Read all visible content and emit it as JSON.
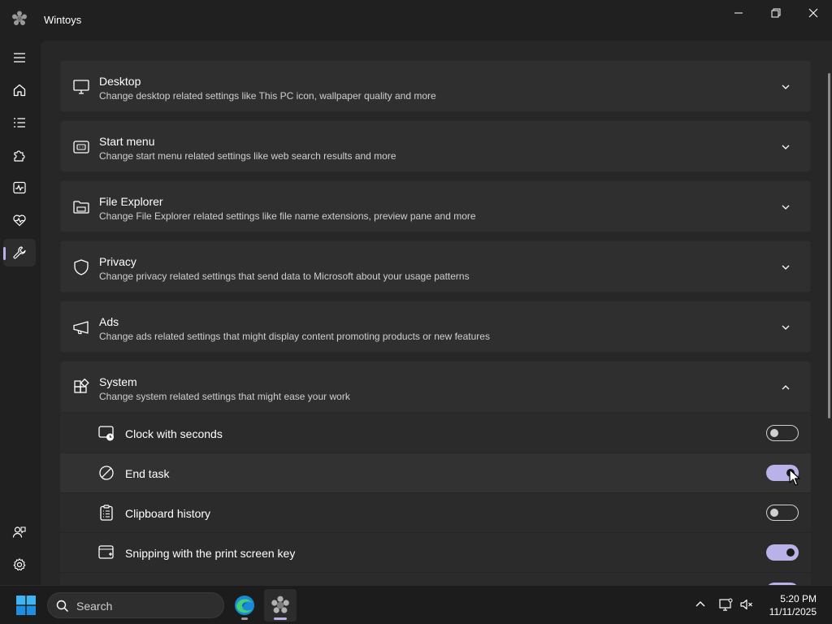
{
  "window": {
    "title": "Wintoys"
  },
  "nav": [
    {
      "icon": "hamburger-menu-icon"
    },
    {
      "icon": "home-icon"
    },
    {
      "icon": "apps-list-icon"
    },
    {
      "icon": "puzzle-icon"
    },
    {
      "icon": "performance-icon"
    },
    {
      "icon": "health-icon"
    },
    {
      "icon": "tweaks-wrench-icon",
      "active": true
    },
    {
      "icon": "account-icon"
    },
    {
      "icon": "settings-gear-icon"
    }
  ],
  "sections": [
    {
      "title": "Desktop",
      "subtitle": "Change desktop related settings like This PC icon, wallpaper quality and more",
      "icon": "monitor-icon",
      "expanded": false
    },
    {
      "title": "Start menu",
      "subtitle": "Change start menu related settings like web search results and more",
      "icon": "start-menu-icon",
      "expanded": false
    },
    {
      "title": "File Explorer",
      "subtitle": "Change File Explorer related settings like file name extensions, preview pane and more",
      "icon": "folder-icon",
      "expanded": false
    },
    {
      "title": "Privacy",
      "subtitle": "Change privacy related settings that send data to Microsoft about your usage patterns",
      "icon": "shield-icon",
      "expanded": false
    },
    {
      "title": "Ads",
      "subtitle": "Change ads related settings that might display content promoting products or new features",
      "icon": "megaphone-icon",
      "expanded": false
    },
    {
      "title": "System",
      "subtitle": "Change system related settings that might ease your work",
      "icon": "apps-grid-icon",
      "expanded": true
    }
  ],
  "system_settings": [
    {
      "label": "Clock with seconds",
      "icon": "clock-icon",
      "enabled": false
    },
    {
      "label": "End task",
      "icon": "block-icon",
      "enabled": true
    },
    {
      "label": "Clipboard history",
      "icon": "clipboard-icon",
      "enabled": false
    },
    {
      "label": "Snipping with the print screen key",
      "icon": "screenshot-icon",
      "enabled": true
    }
  ],
  "taskbar": {
    "search_placeholder": "Search",
    "time": "5:20 PM",
    "date": "11/11/2025",
    "apps": [
      "edge-icon",
      "wintoys-icon"
    ]
  },
  "colors": {
    "accent": "#b9b2e8",
    "background": "#202020",
    "card": "#2f2f2f"
  }
}
